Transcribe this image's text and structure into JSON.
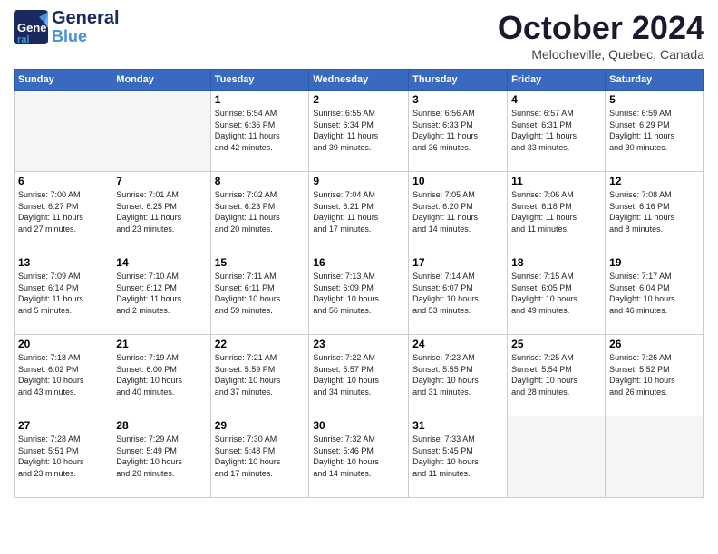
{
  "header": {
    "logo_general": "General",
    "logo_blue": "Blue",
    "month": "October 2024",
    "location": "Melocheville, Quebec, Canada"
  },
  "days_of_week": [
    "Sunday",
    "Monday",
    "Tuesday",
    "Wednesday",
    "Thursday",
    "Friday",
    "Saturday"
  ],
  "weeks": [
    [
      {
        "day": "",
        "info": ""
      },
      {
        "day": "",
        "info": ""
      },
      {
        "day": "1",
        "info": "Sunrise: 6:54 AM\nSunset: 6:36 PM\nDaylight: 11 hours\nand 42 minutes."
      },
      {
        "day": "2",
        "info": "Sunrise: 6:55 AM\nSunset: 6:34 PM\nDaylight: 11 hours\nand 39 minutes."
      },
      {
        "day": "3",
        "info": "Sunrise: 6:56 AM\nSunset: 6:33 PM\nDaylight: 11 hours\nand 36 minutes."
      },
      {
        "day": "4",
        "info": "Sunrise: 6:57 AM\nSunset: 6:31 PM\nDaylight: 11 hours\nand 33 minutes."
      },
      {
        "day": "5",
        "info": "Sunrise: 6:59 AM\nSunset: 6:29 PM\nDaylight: 11 hours\nand 30 minutes."
      }
    ],
    [
      {
        "day": "6",
        "info": "Sunrise: 7:00 AM\nSunset: 6:27 PM\nDaylight: 11 hours\nand 27 minutes."
      },
      {
        "day": "7",
        "info": "Sunrise: 7:01 AM\nSunset: 6:25 PM\nDaylight: 11 hours\nand 23 minutes."
      },
      {
        "day": "8",
        "info": "Sunrise: 7:02 AM\nSunset: 6:23 PM\nDaylight: 11 hours\nand 20 minutes."
      },
      {
        "day": "9",
        "info": "Sunrise: 7:04 AM\nSunset: 6:21 PM\nDaylight: 11 hours\nand 17 minutes."
      },
      {
        "day": "10",
        "info": "Sunrise: 7:05 AM\nSunset: 6:20 PM\nDaylight: 11 hours\nand 14 minutes."
      },
      {
        "day": "11",
        "info": "Sunrise: 7:06 AM\nSunset: 6:18 PM\nDaylight: 11 hours\nand 11 minutes."
      },
      {
        "day": "12",
        "info": "Sunrise: 7:08 AM\nSunset: 6:16 PM\nDaylight: 11 hours\nand 8 minutes."
      }
    ],
    [
      {
        "day": "13",
        "info": "Sunrise: 7:09 AM\nSunset: 6:14 PM\nDaylight: 11 hours\nand 5 minutes."
      },
      {
        "day": "14",
        "info": "Sunrise: 7:10 AM\nSunset: 6:12 PM\nDaylight: 11 hours\nand 2 minutes."
      },
      {
        "day": "15",
        "info": "Sunrise: 7:11 AM\nSunset: 6:11 PM\nDaylight: 10 hours\nand 59 minutes."
      },
      {
        "day": "16",
        "info": "Sunrise: 7:13 AM\nSunset: 6:09 PM\nDaylight: 10 hours\nand 56 minutes."
      },
      {
        "day": "17",
        "info": "Sunrise: 7:14 AM\nSunset: 6:07 PM\nDaylight: 10 hours\nand 53 minutes."
      },
      {
        "day": "18",
        "info": "Sunrise: 7:15 AM\nSunset: 6:05 PM\nDaylight: 10 hours\nand 49 minutes."
      },
      {
        "day": "19",
        "info": "Sunrise: 7:17 AM\nSunset: 6:04 PM\nDaylight: 10 hours\nand 46 minutes."
      }
    ],
    [
      {
        "day": "20",
        "info": "Sunrise: 7:18 AM\nSunset: 6:02 PM\nDaylight: 10 hours\nand 43 minutes."
      },
      {
        "day": "21",
        "info": "Sunrise: 7:19 AM\nSunset: 6:00 PM\nDaylight: 10 hours\nand 40 minutes."
      },
      {
        "day": "22",
        "info": "Sunrise: 7:21 AM\nSunset: 5:59 PM\nDaylight: 10 hours\nand 37 minutes."
      },
      {
        "day": "23",
        "info": "Sunrise: 7:22 AM\nSunset: 5:57 PM\nDaylight: 10 hours\nand 34 minutes."
      },
      {
        "day": "24",
        "info": "Sunrise: 7:23 AM\nSunset: 5:55 PM\nDaylight: 10 hours\nand 31 minutes."
      },
      {
        "day": "25",
        "info": "Sunrise: 7:25 AM\nSunset: 5:54 PM\nDaylight: 10 hours\nand 28 minutes."
      },
      {
        "day": "26",
        "info": "Sunrise: 7:26 AM\nSunset: 5:52 PM\nDaylight: 10 hours\nand 26 minutes."
      }
    ],
    [
      {
        "day": "27",
        "info": "Sunrise: 7:28 AM\nSunset: 5:51 PM\nDaylight: 10 hours\nand 23 minutes."
      },
      {
        "day": "28",
        "info": "Sunrise: 7:29 AM\nSunset: 5:49 PM\nDaylight: 10 hours\nand 20 minutes."
      },
      {
        "day": "29",
        "info": "Sunrise: 7:30 AM\nSunset: 5:48 PM\nDaylight: 10 hours\nand 17 minutes."
      },
      {
        "day": "30",
        "info": "Sunrise: 7:32 AM\nSunset: 5:46 PM\nDaylight: 10 hours\nand 14 minutes."
      },
      {
        "day": "31",
        "info": "Sunrise: 7:33 AM\nSunset: 5:45 PM\nDaylight: 10 hours\nand 11 minutes."
      },
      {
        "day": "",
        "info": ""
      },
      {
        "day": "",
        "info": ""
      }
    ]
  ]
}
